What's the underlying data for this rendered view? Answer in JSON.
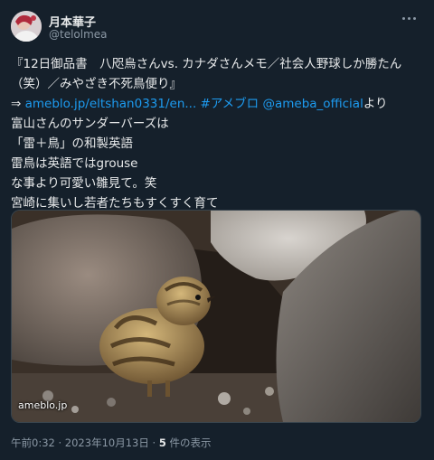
{
  "author": {
    "name": "月本華子",
    "handle": "@telolmea"
  },
  "tweet": {
    "line1": "『12日御品書　八咫烏さんvs. カナダさんメモ／社会人野球しか勝たん",
    "line2": "（笑）／みやざき不死鳥便り』",
    "line3_prefix": "⇒ ",
    "line3_link": "ameblo.jp/eltshan0331/en...",
    "line3_hashtag": "#アメブロ",
    "line3_mention": "@ameba_official",
    "line3_suffix": "より",
    "line4": "富山さんのサンダーバーズは",
    "line5": "「雷＋鳥」の和製英語",
    "line6": "雷鳥は英語ではgrouse",
    "line7": "な事より可愛い雛見て。笑",
    "line8": "宮崎に集いし若者たちもすくすく育て"
  },
  "media": {
    "source": "ameblo.jp"
  },
  "meta": {
    "time": "午前0:32",
    "separator": " · ",
    "date": "2023年10月13日",
    "count": "5",
    "count_label": " 件の表示"
  }
}
